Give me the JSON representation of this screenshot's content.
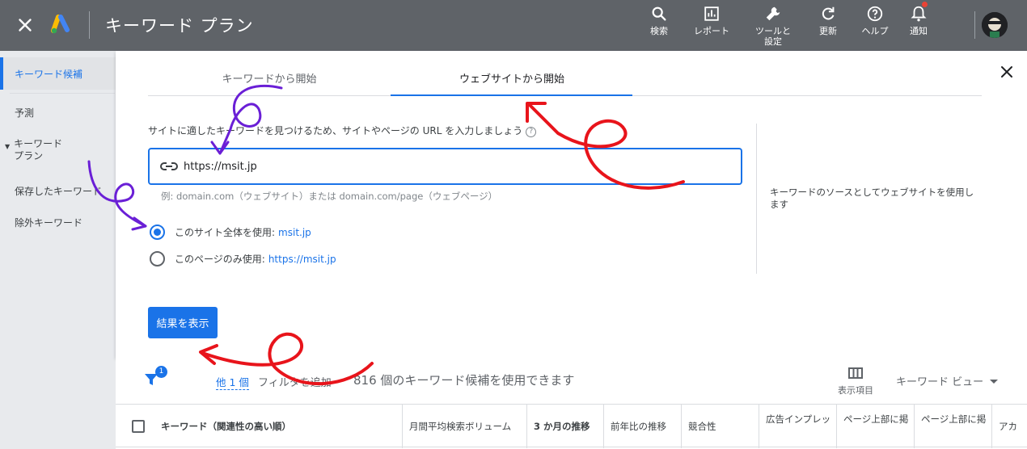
{
  "header": {
    "title": "キーワード プラン",
    "nav": [
      {
        "label": "検索",
        "icon": "search-icon"
      },
      {
        "label": "レポート",
        "icon": "report-icon"
      },
      {
        "label": "ツールと\n設定",
        "icon": "wrench-icon"
      },
      {
        "label": "更新",
        "icon": "refresh-icon"
      },
      {
        "label": "ヘルプ",
        "icon": "help-icon"
      },
      {
        "label": "通知",
        "icon": "bell-icon"
      }
    ]
  },
  "sidebar": {
    "items": [
      {
        "label": "キーワード候補"
      },
      {
        "label": "予測"
      },
      {
        "label": "キーワード\nプラン"
      },
      {
        "label": "保存したキーワード"
      },
      {
        "label": "除外キーワード"
      }
    ]
  },
  "panel": {
    "tabs": [
      {
        "label": "キーワードから開始"
      },
      {
        "label": "ウェブサイトから開始"
      }
    ],
    "instruction": "サイトに適したキーワードを見つけるため、サイトやページの URL を入力しましょう",
    "url_value": "https://msit.jp",
    "example": "例: domain.com（ウェブサイト）または domain.com/page（ウェブページ）",
    "radio_site_label": "このサイト全体を使用:",
    "radio_site_value": "msit.jp",
    "radio_page_label": "このページのみ使用:",
    "radio_page_value": "https://msit.jp",
    "side_note": "キーワードのソースとしてウェブサイトを使用します",
    "submit_label": "結果を表示"
  },
  "results": {
    "filter_badge": "1",
    "other_count": "他 1 個",
    "add_filter": "フィルタを追加",
    "count_message": "816 個のキーワード候補を使用できます",
    "columns_label": "表示項目",
    "view_label": "キーワード ビュー",
    "table_headers": [
      "キーワード（関連性の高い順）",
      "月間平均検索ボリューム",
      "3 か月の推移",
      "前年比の推移",
      "競合性",
      "広告インプレッ",
      "ページ上部に掲",
      "ページ上部に掲",
      "アカ"
    ]
  },
  "colors": {
    "accent": "#1a73e8",
    "topbar": "#5f6368",
    "annotation_red": "#e8141b",
    "annotation_purple": "#6a1fd6"
  }
}
